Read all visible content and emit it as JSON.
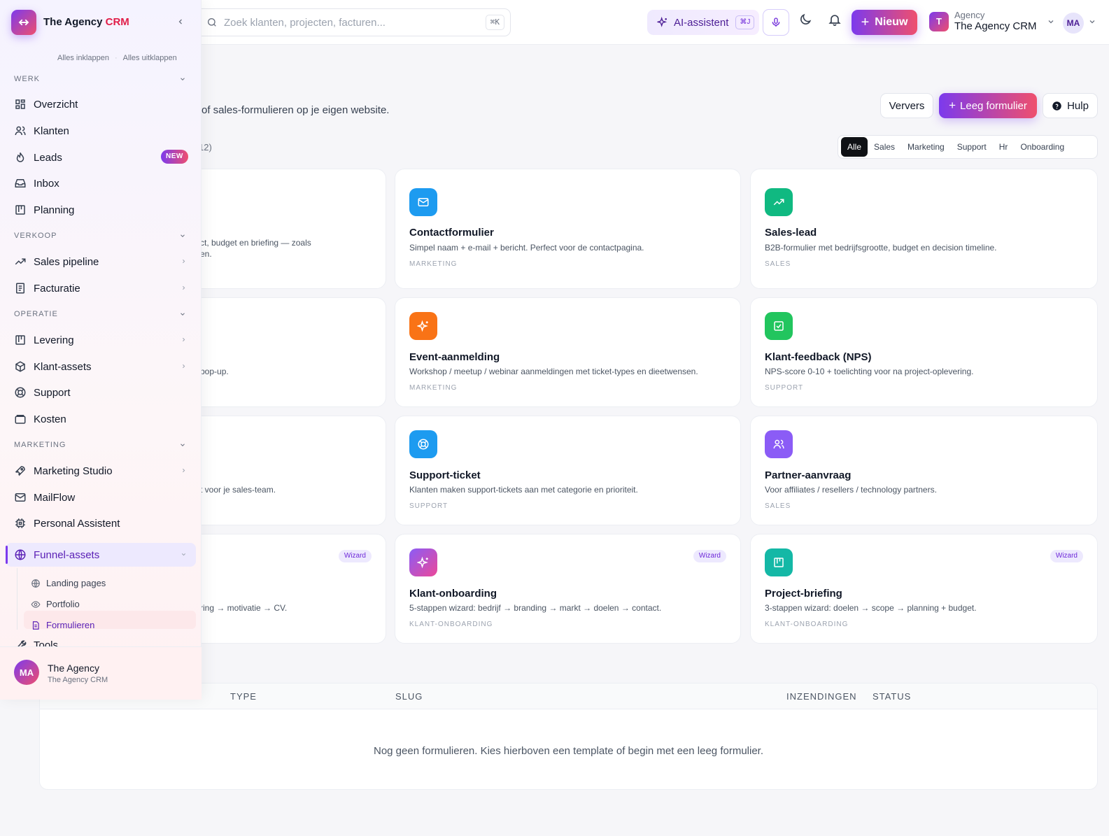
{
  "topbar": {
    "search_placeholder": "Zoek klanten, projecten, facturen...",
    "search_shortcut": "⌘K",
    "ai_label": "AI-assistent",
    "ai_shortcut": "⌘J",
    "new_label": "Nieuw",
    "agency_badge": "T",
    "agency_kind": "Agency",
    "agency_name": "The Agency CRM",
    "avatar": "MA"
  },
  "header": {
    "subtitle": "of sales-formulieren op je eigen website.",
    "refresh_label": "Ververs",
    "empty_form_label": "Leeg formulier",
    "help_label": "Hulp",
    "count_text": "12)"
  },
  "filters": [
    {
      "label": "Alle",
      "active": true
    },
    {
      "label": "Sales",
      "active": false
    },
    {
      "label": "Marketing",
      "active": false
    },
    {
      "label": "Support",
      "active": false
    },
    {
      "label": "Hr",
      "active": false
    },
    {
      "label": "Onboarding",
      "active": false
    }
  ],
  "partial_cards": [
    {
      "desc_line1": "ct, budget en briefing — zoals",
      "desc_line2": "en."
    },
    {
      "desc_line1": "pop-up."
    },
    {
      "desc_line1": "t voor je sales-team."
    },
    {
      "desc_line1": "ring → motivatie → CV.",
      "badge": "Wizard"
    }
  ],
  "cards": [
    {
      "title": "Contactformulier",
      "desc": "Simpel naam + e-mail + bericht. Perfect voor de contactpagina.",
      "category": "MARKETING",
      "icon": "mail-icon",
      "color": "#1d9bf0"
    },
    {
      "title": "Sales-lead",
      "desc": "B2B-formulier met bedrijfsgrootte, budget en decision timeline.",
      "category": "SALES",
      "icon": "trending-up-icon",
      "color": "#10b981"
    },
    {
      "title": "Event-aanmelding",
      "desc": "Workshop / meetup / webinar aanmeldingen met ticket-types en dieetwensen.",
      "category": "MARKETING",
      "icon": "sparkles-icon",
      "color": "#f97316"
    },
    {
      "title": "Klant-feedback (NPS)",
      "desc": "NPS-score 0-10 + toelichting voor na project-oplevering.",
      "category": "SUPPORT",
      "icon": "check-square-icon",
      "color": "#22c55e"
    },
    {
      "title": "Support-ticket",
      "desc": "Klanten maken support-tickets aan met categorie en prioriteit.",
      "category": "SUPPORT",
      "icon": "lifebuoy-icon",
      "color": "#1d9bf0"
    },
    {
      "title": "Partner-aanvraag",
      "desc": "Voor affiliates / resellers / technology partners.",
      "category": "SALES",
      "icon": "users-icon",
      "color": "#8b5cf6"
    },
    {
      "title": "Klant-onboarding",
      "desc": "5-stappen wizard: bedrijf → branding → markt → doelen → contact.",
      "category": "KLANT-ONBOARDING",
      "icon": "sparkles-icon",
      "color": "#8b5cf6",
      "badge": "Wizard"
    },
    {
      "title": "Project-briefing",
      "desc": "3-stappen wizard: doelen → scope → planning + budget.",
      "category": "KLANT-ONBOARDING",
      "icon": "kanban-icon",
      "color": "#14b8a6",
      "badge": "Wizard"
    }
  ],
  "table": {
    "columns": [
      "TYPE",
      "SLUG",
      "INZENDINGEN",
      "STATUS"
    ],
    "empty_text": "Nog geen formulieren. Kies hierboven een template of begin met een leeg formulier."
  },
  "sidebar": {
    "brand_main": "The Agency",
    "brand_accent": "CRM",
    "collapse_all": "Alles inklappen",
    "expand_all": "Alles uitklappen",
    "sections": {
      "werk": "WERK",
      "verkoop": "VERKOOP",
      "operatie": "OPERATIE",
      "marketing": "MARKETING"
    },
    "items": {
      "overzicht": "Overzicht",
      "klanten": "Klanten",
      "leads": "Leads",
      "leads_badge": "NEW",
      "inbox": "Inbox",
      "planning": "Planning",
      "sales_pipeline": "Sales pipeline",
      "facturatie": "Facturatie",
      "levering": "Levering",
      "klant_assets": "Klant-assets",
      "support": "Support",
      "kosten": "Kosten",
      "marketing_studio": "Marketing Studio",
      "mailflow": "MailFlow",
      "personal_assistent": "Personal Assistent",
      "funnel_assets": "Funnel-assets",
      "landing_pages": "Landing pages",
      "portfolio": "Portfolio",
      "formulieren": "Formulieren",
      "tools": "Tools"
    },
    "footer": {
      "avatar": "MA",
      "name": "The Agency",
      "sub": "The Agency CRM"
    }
  }
}
